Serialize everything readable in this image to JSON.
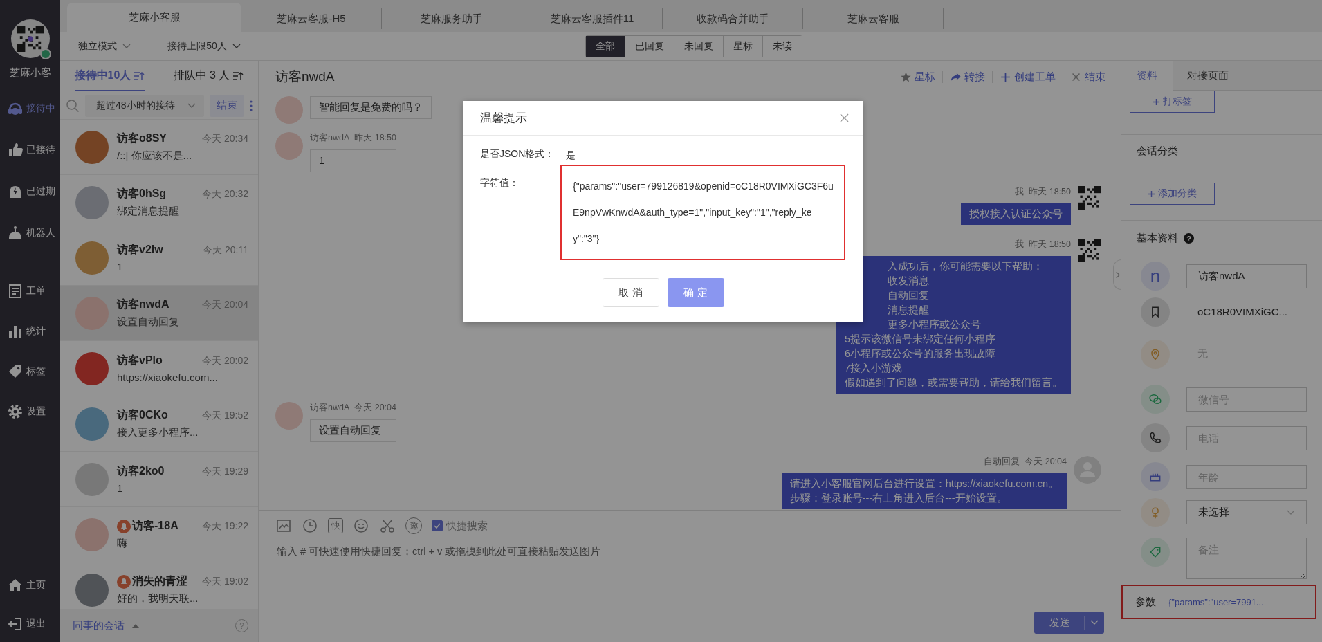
{
  "nav": {
    "brand": "芝麻小客",
    "online": true,
    "main_items": [
      {
        "kind": "headset",
        "label": "接待中",
        "selected": true
      },
      {
        "kind": "thumb",
        "label": "已接待",
        "selected": false
      },
      {
        "kind": "bolt",
        "label": "已过期",
        "selected": false
      },
      {
        "kind": "robot",
        "label": "机器人",
        "selected": false
      }
    ],
    "tool_items": [
      {
        "kind": "form",
        "label": "工单",
        "selected": false
      },
      {
        "kind": "chart",
        "label": "统计",
        "selected": false
      },
      {
        "kind": "tag",
        "label": "标签",
        "selected": false
      },
      {
        "kind": "gear",
        "label": "设置",
        "selected": false
      }
    ],
    "bottom_items": [
      {
        "kind": "home",
        "label": "主页",
        "selected": false
      },
      {
        "kind": "logout",
        "label": "退出",
        "selected": false
      }
    ]
  },
  "top_tabs": [
    {
      "label": "芝麻小客服",
      "selected": true
    },
    {
      "label": "芝麻云客服-H5",
      "selected": false
    },
    {
      "label": "芝麻服务助手",
      "selected": false
    },
    {
      "label": "芝麻云客服插件11",
      "selected": false
    },
    {
      "label": "收款码合并助手",
      "selected": false
    },
    {
      "label": "芝麻云客服",
      "selected": false
    }
  ],
  "mode_select": {
    "value": "独立模式"
  },
  "limit_select": {
    "value": "接待上限50人"
  },
  "filters": [
    {
      "label": "全部",
      "selected": true
    },
    {
      "label": "已回复",
      "selected": false
    },
    {
      "label": "未回复",
      "selected": false
    },
    {
      "label": "星标",
      "selected": false
    },
    {
      "label": "未读",
      "selected": false
    }
  ],
  "list_tabs": [
    {
      "label": "接待中10人",
      "selected": true
    },
    {
      "label": "排队中 3 人",
      "selected": false
    }
  ],
  "list_filter": {
    "value": "超过48小时的接待"
  },
  "end_button": "结束",
  "conversations": [
    {
      "name": "访客o8SY",
      "time": "今天 20:34",
      "preview": "/::| 你应该不是...",
      "alert": false,
      "selected": false
    },
    {
      "name": "访客0hSg",
      "time": "今天 20:32",
      "preview": "绑定消息提醒",
      "alert": false,
      "selected": false
    },
    {
      "name": "访客v2lw",
      "time": "今天 20:11",
      "preview": "1",
      "alert": false,
      "selected": false
    },
    {
      "name": "访客nwdA",
      "time": "今天 20:04",
      "preview": "设置自动回复",
      "alert": false,
      "selected": true
    },
    {
      "name": "访客vPlo",
      "time": "今天 20:02",
      "preview": "https://xiaokefu.com...",
      "alert": false,
      "selected": false
    },
    {
      "name": "访客0CKo",
      "time": "今天 19:52",
      "preview": "接入更多小程序...",
      "alert": false,
      "selected": false
    },
    {
      "name": "访客2ko0",
      "time": "今天 19:29",
      "preview": "1",
      "alert": false,
      "selected": false
    },
    {
      "name": "访客-18A",
      "time": "今天 19:22",
      "preview": "嗨",
      "alert": true,
      "selected": false
    },
    {
      "name": "消失的青涩",
      "time": "今天 19:02",
      "preview": "好的，我明天联...",
      "alert": true,
      "selected": false
    }
  ],
  "colleagues": {
    "label": "同事的会话",
    "help": "?"
  },
  "chat": {
    "title": "访客nwdA",
    "actions": [
      {
        "kind": "star",
        "label": "星标"
      },
      {
        "kind": "transfer",
        "label": "转接"
      },
      {
        "kind": "add",
        "label": "创建工单"
      },
      {
        "kind": "close",
        "label": "结束"
      }
    ],
    "messages": [
      {
        "kind": "incoming",
        "lines": [
          {
            "text": "智能回复是免费的吗？",
            "covered": false
          }
        ]
      },
      {
        "kind": "incoming",
        "sender": "访客nwdA",
        "time": "昨天 18:50",
        "lines": [
          {
            "text": "1",
            "covered": false
          }
        ]
      },
      {
        "kind": "outgoing",
        "sender": "我",
        "time": "昨天 18:50",
        "lines": [
          {
            "text": "授权接入认证公众号",
            "covered": false
          }
        ]
      },
      {
        "kind": "outgoing",
        "sender": "我",
        "time": "昨天 18:50",
        "lines": [
          {
            "text": "入成功后，你可能需要以下帮助：",
            "covered": true
          },
          {
            "text": "收发消息",
            "covered": true
          },
          {
            "text": "自动回复",
            "covered": true
          },
          {
            "text": "消息提醒",
            "covered": true
          },
          {
            "text": "更多小程序或公众号",
            "covered": true
          },
          {
            "text": "5提示该微信号未绑定任何小程序",
            "covered": false
          },
          {
            "text": "6小程序或公众号的服务出现故障",
            "covered": false
          },
          {
            "text": "7接入小游戏",
            "covered": false
          },
          {
            "text": "假如遇到了问题，或需要帮助，请给我们留言。",
            "covered": false
          }
        ]
      },
      {
        "kind": "incoming",
        "sender": "访客nwdA",
        "time": "今天 20:04",
        "lines": [
          {
            "text": "设置自动回复",
            "covered": false
          }
        ]
      },
      {
        "kind": "auto",
        "sender": "自动回复",
        "time": "今天 20:04",
        "lines": [
          {
            "text": "请进入小客服官网后台进行设置：https://xiaokefu.com.cn。",
            "covered": false
          },
          {
            "text": "步骤：登录账号---右上角进入后台---开始设置。",
            "covered": false
          }
        ]
      }
    ]
  },
  "composer": {
    "tools": [
      {
        "kind": "image"
      },
      {
        "kind": "clock"
      },
      {
        "kind": "boxed",
        "label": "快"
      },
      {
        "kind": "smile"
      },
      {
        "kind": "scissors"
      },
      {
        "kind": "circled",
        "label": "邀"
      }
    ],
    "quick_search": {
      "label": "快捷搜索",
      "checked": true
    },
    "placeholder": "输入 # 可快速使用快捷回复；ctrl + v 或拖拽到此处可直接粘贴发送图片",
    "send": "发送"
  },
  "profile": {
    "tabs": [
      {
        "label": "资料",
        "selected": true
      },
      {
        "label": "对接页面",
        "selected": false
      }
    ],
    "tag_button": "打标签",
    "category_title": "会话分类",
    "category_button": "添加分类",
    "basic_title": "基本资料",
    "basic_help": "?",
    "fields": [
      {
        "kind": "input",
        "icon_text": "n",
        "value": "访客nwdA"
      },
      {
        "kind": "text",
        "value": "oC18R0VIMXiGC...",
        "muted": false
      },
      {
        "kind": "text",
        "value": "无",
        "muted": true
      },
      {
        "kind": "input",
        "placeholder": "微信号"
      },
      {
        "kind": "input",
        "placeholder": "电话"
      },
      {
        "kind": "input",
        "placeholder": "年龄"
      },
      {
        "kind": "select",
        "value": "未选择"
      },
      {
        "kind": "textarea",
        "placeholder": "备注"
      }
    ],
    "params": {
      "label": "参数",
      "value": "{\"params\":\"user=7991...",
      "highlighted": true
    }
  },
  "dialog": {
    "title": "温馨提示",
    "rows": [
      {
        "label": "是否JSON格式：",
        "value": "是",
        "highlighted": false
      },
      {
        "label": "字符值：",
        "value": "{\"params\":\"user=799126819&openid=oC18R0VIMXiGC3F6uE9npVwKnwdA&auth_type=1\",\"input_key\":\"1\",\"reply_key\":\"3\"}",
        "highlighted": true
      }
    ],
    "buttons": [
      {
        "kind": "secondary",
        "label": "取 消"
      },
      {
        "kind": "primary",
        "label": "确 定"
      }
    ]
  }
}
